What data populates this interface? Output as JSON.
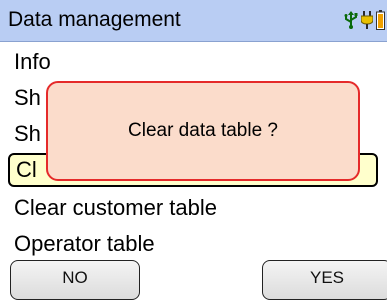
{
  "header": {
    "title": "Data management",
    "icons": [
      "usb-icon",
      "plug-icon",
      "battery-icon"
    ],
    "background_color": "#b9cdf3"
  },
  "menu": {
    "items": [
      {
        "label": "Info"
      },
      {
        "label": "Sh"
      },
      {
        "label": "Sh"
      },
      {
        "label": "Cl",
        "selected": true
      },
      {
        "label": "Clear customer table"
      },
      {
        "label": "Operator table"
      }
    ]
  },
  "dialog": {
    "message": "Clear data table ?",
    "border_color": "#e52a2a",
    "background_color": "#fbdccb"
  },
  "softkeys": {
    "left_label": "NO",
    "right_label": "YES"
  }
}
